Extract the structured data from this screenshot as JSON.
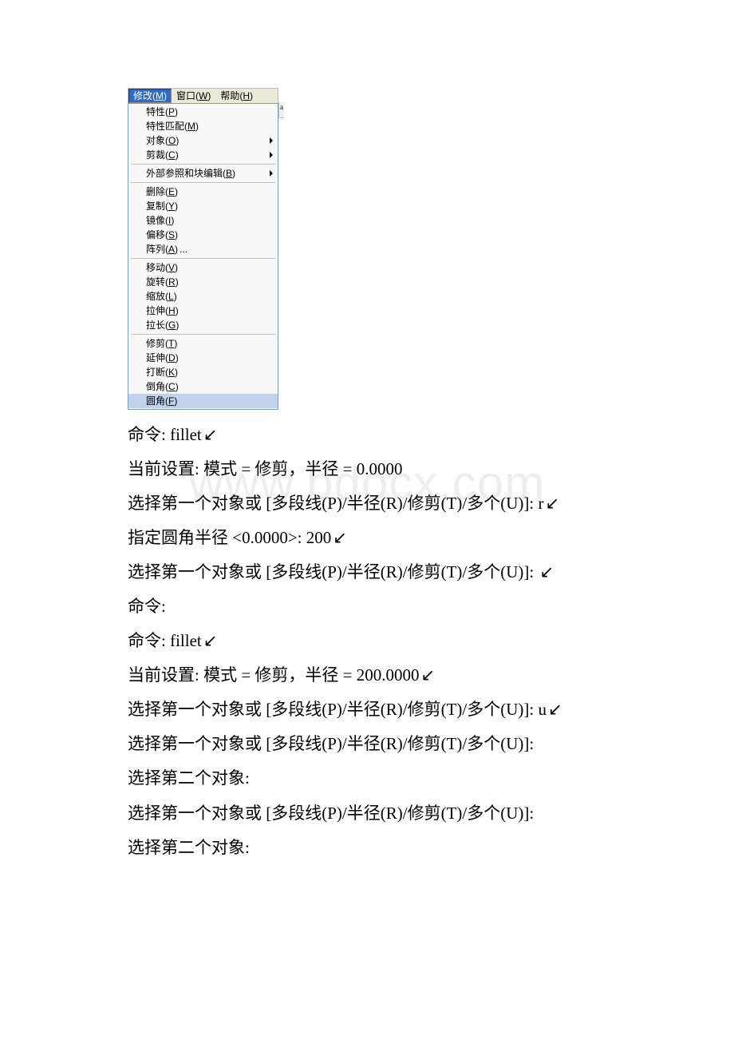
{
  "watermark": "www.bdocx.com",
  "menubar": {
    "modify": {
      "text": "修改",
      "key": "M"
    },
    "window": {
      "text": "窗口",
      "key": "W"
    },
    "help": {
      "text": "帮助",
      "key": "H"
    }
  },
  "decor_char": "a",
  "menu": {
    "properties": {
      "text": "特性",
      "key": "P"
    },
    "match_prop": {
      "text": "特性匹配",
      "key": "M"
    },
    "object": {
      "text": "对象",
      "key": "O"
    },
    "clip": {
      "text": "剪裁",
      "key": "C"
    },
    "xref_block": {
      "text": "外部参照和块编辑",
      "key": "B"
    },
    "erase": {
      "text": "删除",
      "key": "E"
    },
    "copy": {
      "text": "复制",
      "key": "Y"
    },
    "mirror": {
      "text": "镜像",
      "key": "I"
    },
    "offset": {
      "text": "偏移",
      "key": "S"
    },
    "array": {
      "text": "阵列",
      "key": "A",
      "suffix": "..."
    },
    "move": {
      "text": "移动",
      "key": "V"
    },
    "rotate": {
      "text": "旋转",
      "key": "R"
    },
    "scale": {
      "text": "缩放",
      "key": "L"
    },
    "stretch": {
      "text": "拉伸",
      "key": "H"
    },
    "lengthen": {
      "text": "拉长",
      "key": "G"
    },
    "trim": {
      "text": "修剪",
      "key": "T"
    },
    "extend": {
      "text": "延伸",
      "key": "D"
    },
    "break": {
      "text": "打断",
      "key": "K"
    },
    "chamfer": {
      "text": "倒角",
      "key": "C"
    },
    "fillet": {
      "text": "圆角",
      "key": "F"
    }
  },
  "enter_glyph": "↙",
  "cmd": {
    "l01": "命令: fillet",
    "l02": "当前设置: 模式 = 修剪，半径 = 0.0000",
    "l03": "选择第一个对象或 [多段线(P)/半径(R)/修剪(T)/多个(U)]: r",
    "l04": "指定圆角半径 <0.0000>: 200",
    "l05": "选择第一个对象或 [多段线(P)/半径(R)/修剪(T)/多个(U)]: ",
    "l06": "命令:",
    "l07": "命令: fillet",
    "l08": "当前设置: 模式 = 修剪，半径 = 200.0000",
    "l09": "选择第一个对象或 [多段线(P)/半径(R)/修剪(T)/多个(U)]: u",
    "l10": "选择第一个对象或 [多段线(P)/半径(R)/修剪(T)/多个(U)]:",
    "l11": "选择第二个对象:",
    "l12": "选择第一个对象或 [多段线(P)/半径(R)/修剪(T)/多个(U)]:",
    "l13": "选择第二个对象:"
  }
}
